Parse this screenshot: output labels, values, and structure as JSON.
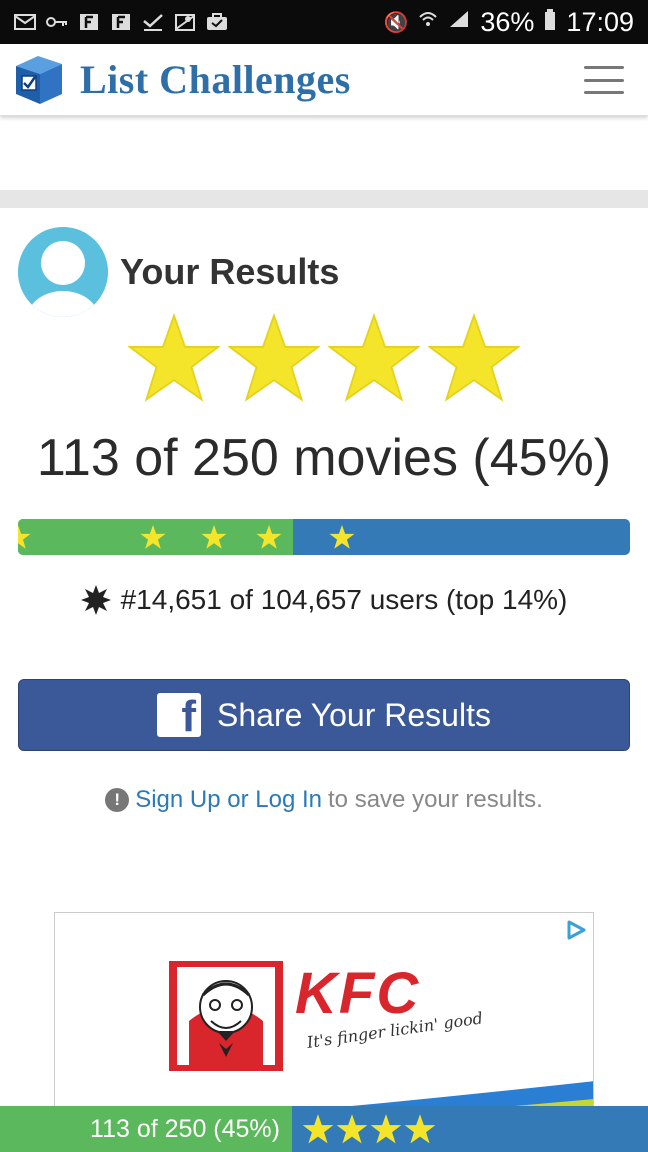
{
  "status_bar": {
    "battery": "36%",
    "time": "17:09",
    "icons": [
      "mail-icon",
      "key-icon",
      "f-icon",
      "f-icon",
      "check-icon",
      "map-icon",
      "briefcase-icon",
      "mute-icon",
      "wifi-icon",
      "signal-icon",
      "battery-icon"
    ]
  },
  "header": {
    "brand": "List Challenges",
    "menu_icon": "hamburger-icon"
  },
  "results": {
    "title": "Your Results",
    "stars_rating": 4,
    "stars_total": 4,
    "score_text": "113 of 250 movies (45%)",
    "progress_fraction": 0.45,
    "rank_text": "#14,651 of 104,657 users (top 14%)"
  },
  "share": {
    "label": "Share Your Results",
    "icon": "facebook-icon"
  },
  "signup": {
    "link_text": "Sign Up or Log In",
    "suffix_text": " to save your results."
  },
  "ad": {
    "brand": "KFC",
    "tagline": "It's finger lickin' good",
    "adchoices_icon": "adchoices-icon"
  },
  "bottom_bar": {
    "score_text": "113 of 250 (45%)",
    "stars": 4
  },
  "colors": {
    "green": "#5cb85c",
    "blue": "#337ab7",
    "star": "#f5e52a",
    "facebook": "#3b5998",
    "link": "#2a7ab9",
    "brand": "#2f6fa8"
  }
}
